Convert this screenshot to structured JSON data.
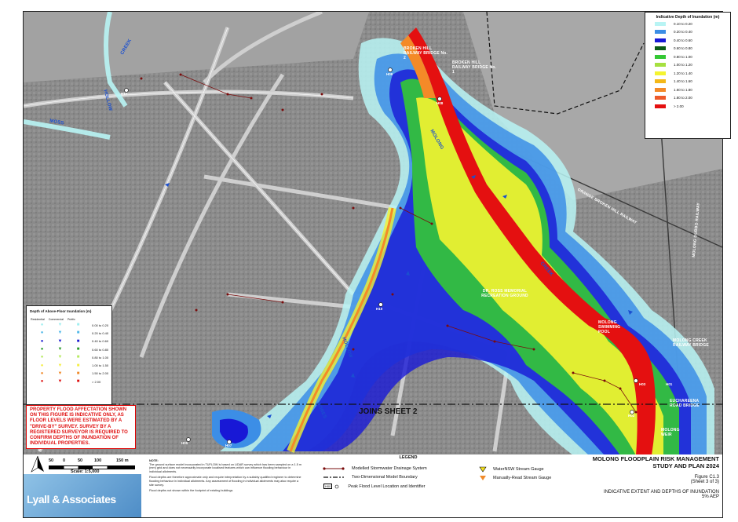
{
  "labels": {
    "broken_hill_bridge_2": "BROKEN HILL RAILWAY BRIDGE No. 2",
    "broken_hill_bridge_1": "BROKEN HILL RAILWAY BRIDGE No. 1",
    "moss_creek": "MOSS",
    "creek_top": "CREEK",
    "molong_creek": "MOLONG",
    "creek": "CREEK",
    "hollow_top": "HOLLOW",
    "hollow_bottom": "HOLLOW",
    "rec_ground": "DR. ROSS MEMORIAL RECREATION GROUND",
    "swimming_pool": "MOLONG SWIMMING POOL",
    "molong_creek_bridge": "MOLONG CREEK RAILWAY BRIDGE",
    "euchareena_bridge": "EUCHAREENA ROAD BRIDGE",
    "weir": "MOLONG WEIR",
    "orange_broken_hill_rail": "ORANGE BROKEN HILL RAILWAY",
    "molong_dubbo_rail": "MOLONG DUBBO RAILWAY",
    "bores": "BORES"
  },
  "nodes": [
    "H12",
    "H09",
    "H08",
    "H10",
    "H02",
    "H07",
    "H03",
    "H01",
    "H05"
  ],
  "depth_legend": {
    "title": "Indicative Depth of Inundation (m)",
    "items": [
      {
        "label": "0.10 to 0.20",
        "color": "#b8f4f4"
      },
      {
        "label": "0.20 to 0.40",
        "color": "#3c8ee6"
      },
      {
        "label": "0.40 to 0.60",
        "color": "#1818d6"
      },
      {
        "label": "0.60 to 0.80",
        "color": "#0c5c16"
      },
      {
        "label": "0.80 to 1.00",
        "color": "#34c834"
      },
      {
        "label": "1.00 to 1.20",
        "color": "#a6e040"
      },
      {
        "label": "1.20 to 1.40",
        "color": "#f4f430"
      },
      {
        "label": "1.40 to 1.60",
        "color": "#f4b818"
      },
      {
        "label": "1.60 to 1.80",
        "color": "#f48a28"
      },
      {
        "label": "1.80 to 2.00",
        "color": "#ee5a2a"
      },
      {
        "label": "> 2.00",
        "color": "#e41010"
      }
    ]
  },
  "floor_legend": {
    "title": "Depth of Above-Floor Inundation (m)",
    "headers": [
      "Residential",
      "Commercial",
      "Public"
    ],
    "items": [
      {
        "label": "0.00 to 0.20",
        "color": "#9feef0"
      },
      {
        "label": "0.20 to 0.40",
        "color": "#50b8e8"
      },
      {
        "label": "0.40 to 0.60",
        "color": "#1a1ad0"
      },
      {
        "label": "0.60 to 0.80",
        "color": "#2a9a2a"
      },
      {
        "label": "0.80 to 1.00",
        "color": "#b6ea60"
      },
      {
        "label": "1.00 to 1.50",
        "color": "#f4ee40"
      },
      {
        "label": "1.50 to 2.00",
        "color": "#f08a2a"
      },
      {
        "label": "> 2.00",
        "color": "#dd1010"
      }
    ]
  },
  "warning": "PROPERTY FLOOD AFFECTATION SHOWN ON THIS FIGURE IS INDICATIVE ONLY, AS FLOOR LEVELS WERE ESTIMATED BY A \"DRIVE-BY\" SURVEY. SURVEY BY A REGISTERED SURVEYOR IS REQUIRED TO CONFIRM DEPTHS OF INUNDATION OF INDIVIDUAL PROPERTIES.",
  "joins": "JOINS SHEET 2",
  "scale": {
    "ticks": [
      "50",
      "0",
      "50",
      "100",
      "150 m"
    ],
    "text": "Scale: 1:5,000"
  },
  "note": {
    "heading": "NOTE:",
    "p1": "The ground surface model incorporated in TUFLOW is based on LiDAR survey which has been sampled on a 1.5 m (mm) grid and does not necessarily incorporate localised features which can influence flooding behaviour in individual allotments.",
    "p2": "Flood depths are therefore approximate only and require interpretation by a suitably qualified engineer to determine flooding behaviour in individual allotments. Any assessment of flooding in individual allotments may also require a site survey.",
    "p3": "Flood depths not shown within the footprint of existing buildings"
  },
  "legend": {
    "title": "LEGEND",
    "stormwater": "Modelled Stormwater Drainage System",
    "boundary": "Two-Dimensional Model Boundary",
    "peak": "Peak Flood Level Location and Identifier",
    "peak_id": "H00",
    "waternsw": "WaterNSW Stream Gauge",
    "manual": "Manually-Read Stream Gauge"
  },
  "logo": "Lyall & Associates",
  "title_block": {
    "line1": "MOLONG FLOODPLAIN RISK MANAGEMENT",
    "line2": "STUDY AND PLAN 2024",
    "figure": "Figure C1.3",
    "sheet": "(Sheet 3 of 3)",
    "caption": "INDICATIVE EXTENT AND DEPTHS OF INUNDATION",
    "aep": "5% AEP"
  }
}
